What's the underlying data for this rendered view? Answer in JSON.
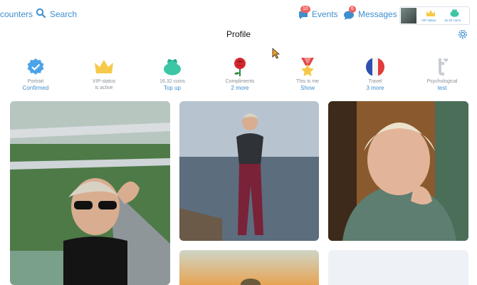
{
  "header": {
    "encounters_label": "counters",
    "search_label": "Search",
    "events_label": "Events",
    "events_count": "10",
    "messages_label": "Messages",
    "messages_count": "6",
    "vip_status_mini": "VIP status",
    "coins_mini": "16.32 coins"
  },
  "page": {
    "title": "Profile"
  },
  "achievements": [
    {
      "icon": "verified-badge-icon",
      "label": "Portrait",
      "action": "Confirmed"
    },
    {
      "icon": "crown-icon",
      "label": "VIP-status\nis active",
      "action": ""
    },
    {
      "icon": "coin-purse-icon",
      "label": "16.32 coins",
      "action": "Top up"
    },
    {
      "icon": "rose-icon",
      "label": "Compliments",
      "action": "2 more"
    },
    {
      "icon": "medal-icon",
      "label": "This is me",
      "action": "Show"
    },
    {
      "icon": "france-flag-icon",
      "label": "Travel",
      "action": "3 more"
    },
    {
      "icon": "psychological-test-icon",
      "label": "Psychological",
      "action": "test"
    }
  ],
  "colors": {
    "accent": "#3d8fd0",
    "badge": "#f06060",
    "label_grey": "#8a8f96"
  }
}
